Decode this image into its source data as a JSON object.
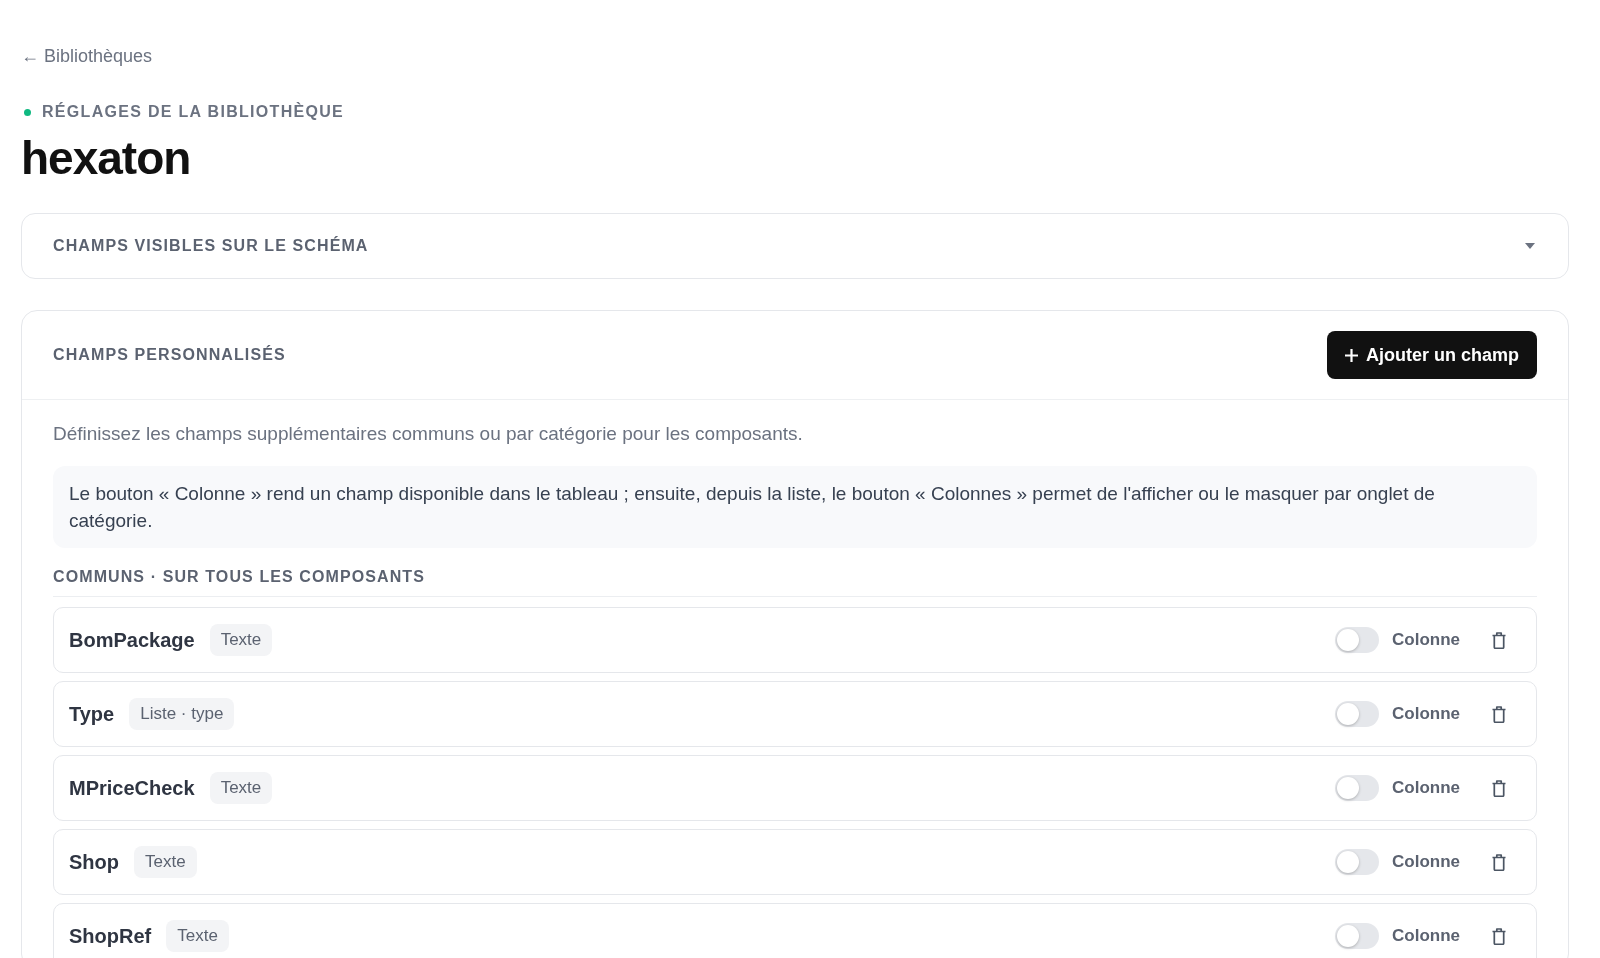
{
  "back_link": "← Bibliothèques",
  "eyebrow": "RÉGLAGES DE LA BIBLIOTHÈQUE",
  "title": "hexaton",
  "visible_fields": {
    "title": "CHAMPS VISIBLES SUR LE SCHÉMA",
    "expanded": false
  },
  "custom_fields": {
    "title": "CHAMPS PERSONNALISÉS",
    "add_button": "Ajouter un champ",
    "description": "Définissez les champs supplémentaires communs ou par catégorie pour les composants.",
    "note": "Le bouton « Colonne » rend un champ disponible dans le tableau ; ensuite, depuis la liste, le bouton « Colonnes » permet de l'afficher ou le masquer par onglet de catégorie.",
    "common_section": {
      "title": "COMMUNS · SUR TOUS LES COMPOSANTS",
      "fields": [
        {
          "name": "BomPackage",
          "type": "Texte",
          "column": {
            "label": "Colonne",
            "on": false
          }
        },
        {
          "name": "Type",
          "type": "Liste · type",
          "column": {
            "label": "Colonne",
            "on": false
          }
        },
        {
          "name": "MPriceCheck",
          "type": "Texte",
          "column": {
            "label": "Colonne",
            "on": false
          }
        },
        {
          "name": "Shop",
          "type": "Texte",
          "column": {
            "label": "Colonne",
            "on": false
          }
        },
        {
          "name": "ShopRef",
          "type": "Texte",
          "column": {
            "label": "Colonne",
            "on": false
          }
        }
      ]
    }
  }
}
